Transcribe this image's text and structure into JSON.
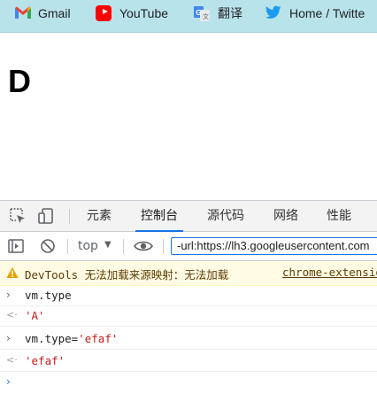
{
  "bookmarks": [
    {
      "label": "Gmail",
      "icon": "gmail-icon"
    },
    {
      "label": "YouTube",
      "icon": "youtube-icon"
    },
    {
      "label": "翻译",
      "icon": "translate-icon"
    },
    {
      "label": "Home / Twitte",
      "icon": "twitter-icon"
    }
  ],
  "page": {
    "heading": "D"
  },
  "devtools": {
    "tabs": [
      {
        "label": "元素"
      },
      {
        "label": "控制台",
        "active": true
      },
      {
        "label": "源代码"
      },
      {
        "label": "网络"
      },
      {
        "label": "性能"
      }
    ],
    "toolbar": {
      "context": "top",
      "filter_value": "-url:https://lh3.googleusercontent.com"
    },
    "warning": {
      "text": "DevTools 无法加载来源映射：无法加载",
      "link": "chrome-extension"
    },
    "console_rows": [
      {
        "kind": "input",
        "prefix": "vm.type",
        "string": ""
      },
      {
        "kind": "output",
        "prefix": "",
        "string": "'A'"
      },
      {
        "kind": "input",
        "prefix": "vm.type=",
        "string": "'efaf'"
      },
      {
        "kind": "output",
        "prefix": "",
        "string": "'efaf'"
      }
    ]
  },
  "colors": {
    "bookmarks_bg": "#b9e3ea",
    "accent": "#1a73e8",
    "warning_bg": "#fffbe5",
    "string": "#c41a16"
  }
}
